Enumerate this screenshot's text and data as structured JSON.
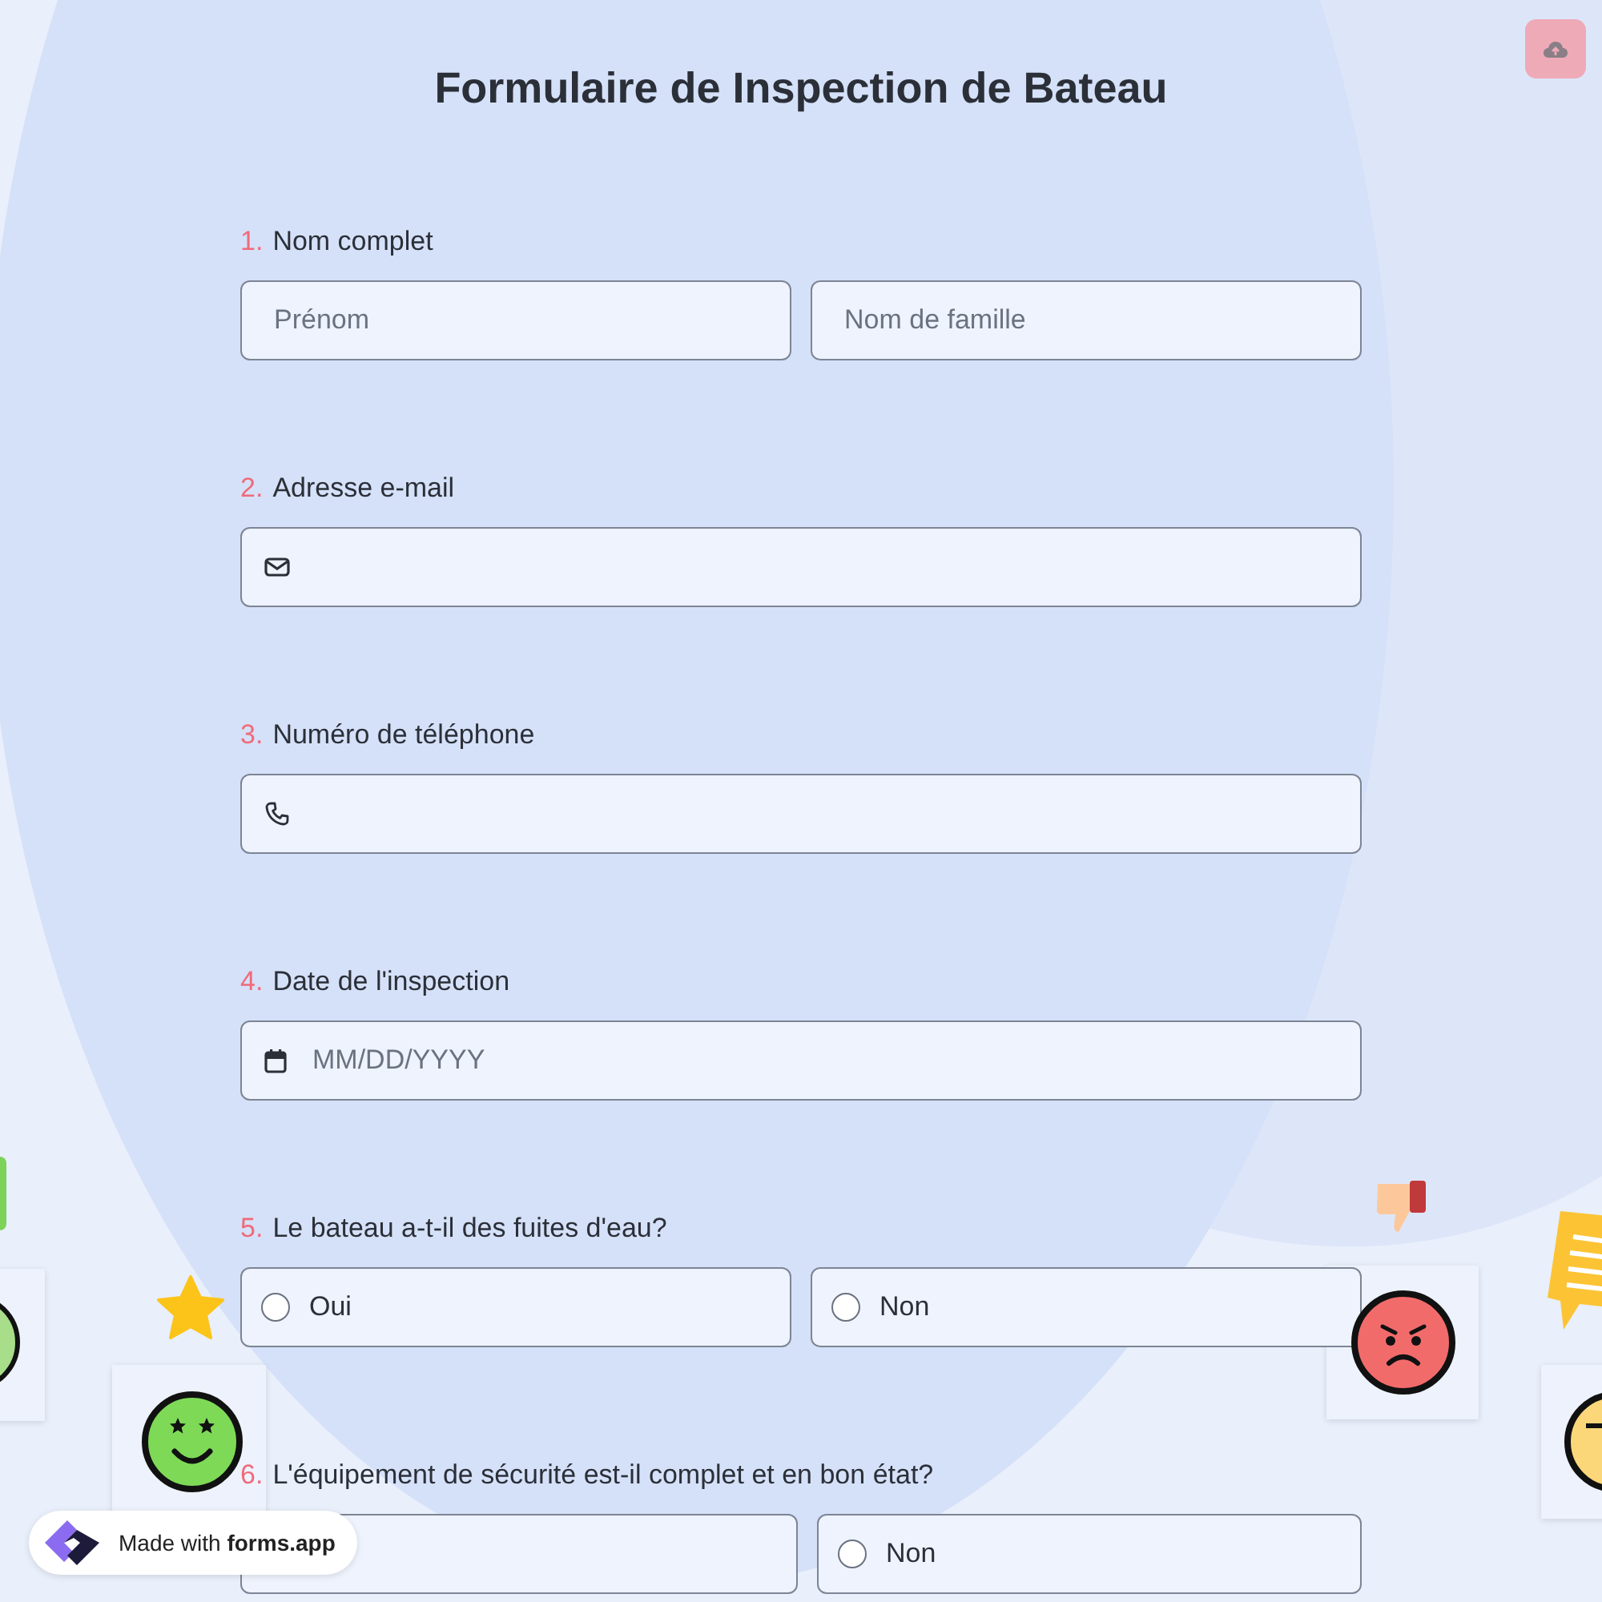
{
  "title": "Formulaire de Inspection de Bateau",
  "questions": [
    {
      "number": "1.",
      "label": "Nom complet",
      "kind": "name",
      "fields": [
        {
          "placeholder": "Prénom"
        },
        {
          "placeholder": "Nom de famille"
        }
      ]
    },
    {
      "number": "2.",
      "label": "Adresse e-mail",
      "kind": "email"
    },
    {
      "number": "3.",
      "label": "Numéro de téléphone",
      "kind": "phone"
    },
    {
      "number": "4.",
      "label": "Date de l'inspection",
      "kind": "date",
      "placeholder": "MM/DD/YYYY"
    },
    {
      "number": "5.",
      "label": "Le bateau a-t-il des fuites d'eau?",
      "kind": "choice",
      "options": [
        {
          "label": "Oui",
          "selected": false
        },
        {
          "label": "Non",
          "selected": false
        }
      ]
    },
    {
      "number": "6.",
      "label": "L'équipement de sécurité est-il complet et en bon état?",
      "kind": "choice",
      "options": [
        {
          "label": "Non",
          "selected": false
        }
      ]
    }
  ],
  "badge": {
    "text": "Made with **forms.app**"
  }
}
